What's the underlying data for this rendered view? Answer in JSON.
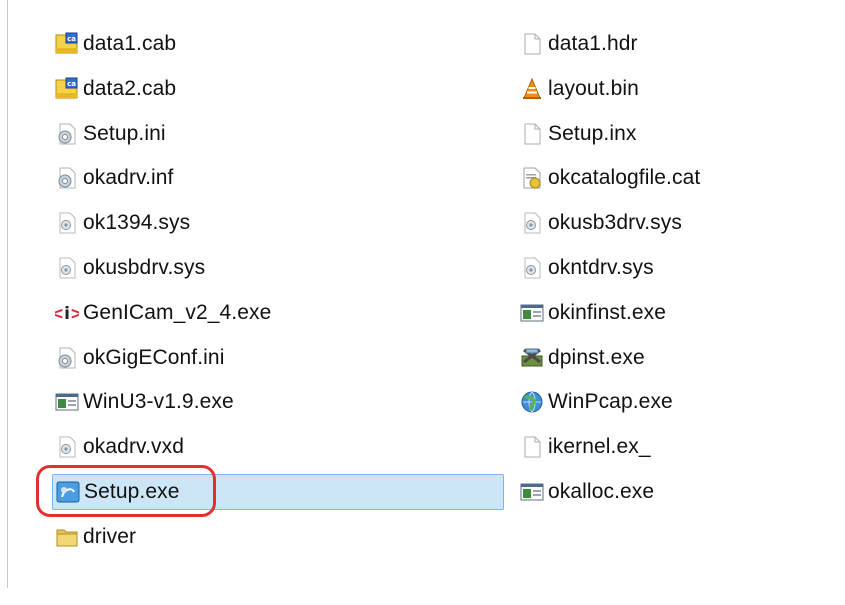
{
  "files_left": [
    {
      "name": "data1.cab",
      "icon": "cab-archive-icon"
    },
    {
      "name": "data2.cab",
      "icon": "cab-archive-icon"
    },
    {
      "name": "Setup.ini",
      "icon": "settings-file-icon"
    },
    {
      "name": "okadrv.inf",
      "icon": "settings-file-icon"
    },
    {
      "name": "ok1394.sys",
      "icon": "system-file-icon"
    },
    {
      "name": "okusbdrv.sys",
      "icon": "system-file-icon"
    },
    {
      "name": "GenICam_v2_4.exe",
      "icon": "genicam-app-icon"
    },
    {
      "name": "okGigEConf.ini",
      "icon": "settings-file-icon"
    },
    {
      "name": "WinU3-v1.9.exe",
      "icon": "application-icon"
    },
    {
      "name": "okadrv.vxd",
      "icon": "system-file-icon"
    },
    {
      "name": "Setup.exe",
      "icon": "setup-installer-icon",
      "selected": true
    },
    {
      "name": "driver",
      "icon": "folder-icon"
    }
  ],
  "files_right": [
    {
      "name": "data1.hdr",
      "icon": "blank-file-icon"
    },
    {
      "name": "layout.bin",
      "icon": "vlc-cone-icon"
    },
    {
      "name": "Setup.inx",
      "icon": "blank-file-icon"
    },
    {
      "name": "okcatalogfile.cat",
      "icon": "security-catalog-icon"
    },
    {
      "name": "okusb3drv.sys",
      "icon": "system-file-icon"
    },
    {
      "name": "okntdrv.sys",
      "icon": "system-file-icon"
    },
    {
      "name": "okinfinst.exe",
      "icon": "application-icon"
    },
    {
      "name": "dpinst.exe",
      "icon": "driver-installer-icon"
    },
    {
      "name": "WinPcap.exe",
      "icon": "winpcap-globe-icon"
    },
    {
      "name": "ikernel.ex_",
      "icon": "blank-file-icon"
    },
    {
      "name": "okalloc.exe",
      "icon": "application-icon"
    }
  ],
  "colors": {
    "selection_bg": "#cde6f7",
    "selection_border": "#7eb4ea",
    "highlight_ring": "#e23030"
  }
}
